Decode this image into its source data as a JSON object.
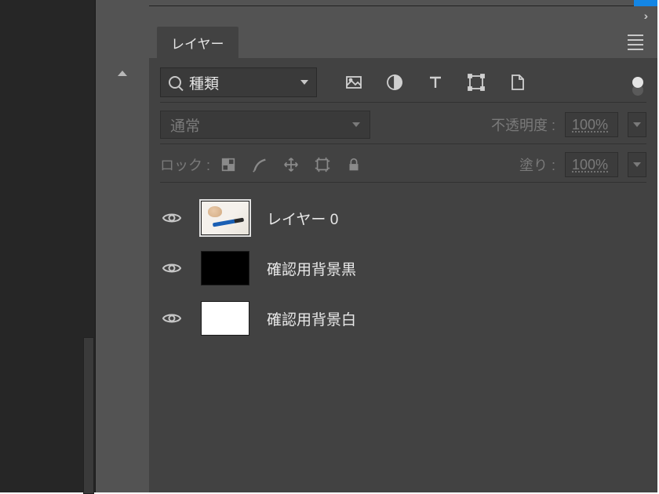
{
  "panel": {
    "tab_label": "レイヤー",
    "search": {
      "value": "種類"
    }
  },
  "blend": {
    "mode": "通常",
    "opacity_label": "不透明度 :",
    "opacity_value": "100%"
  },
  "lock": {
    "label": "ロック :",
    "fill_label": "塗り :",
    "fill_value": "100%"
  },
  "layers": [
    {
      "name": "レイヤー 0"
    },
    {
      "name": "確認用背景黒"
    },
    {
      "name": "確認用背景白"
    }
  ]
}
